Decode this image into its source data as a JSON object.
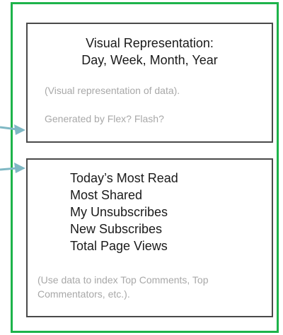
{
  "top_panel": {
    "title_line1": "Visual Representation:",
    "title_line2": "Day, Week, Month, Year",
    "note1": "(Visual representation of data).",
    "note2": "Generated by Flex? Flash?"
  },
  "bottom_panel": {
    "items": [
      "Today’s Most Read",
      "Most Shared",
      "My Unsubscribes",
      "New Subscribes",
      "Total Page Views"
    ],
    "note": "(Use data to index Top Comments, Top Commentators, etc.)."
  },
  "colors": {
    "frame": "#1db34a",
    "panel_border": "#4a4a4a",
    "arrow": "#7fb8c4",
    "note_text": "#a8a8a8"
  }
}
